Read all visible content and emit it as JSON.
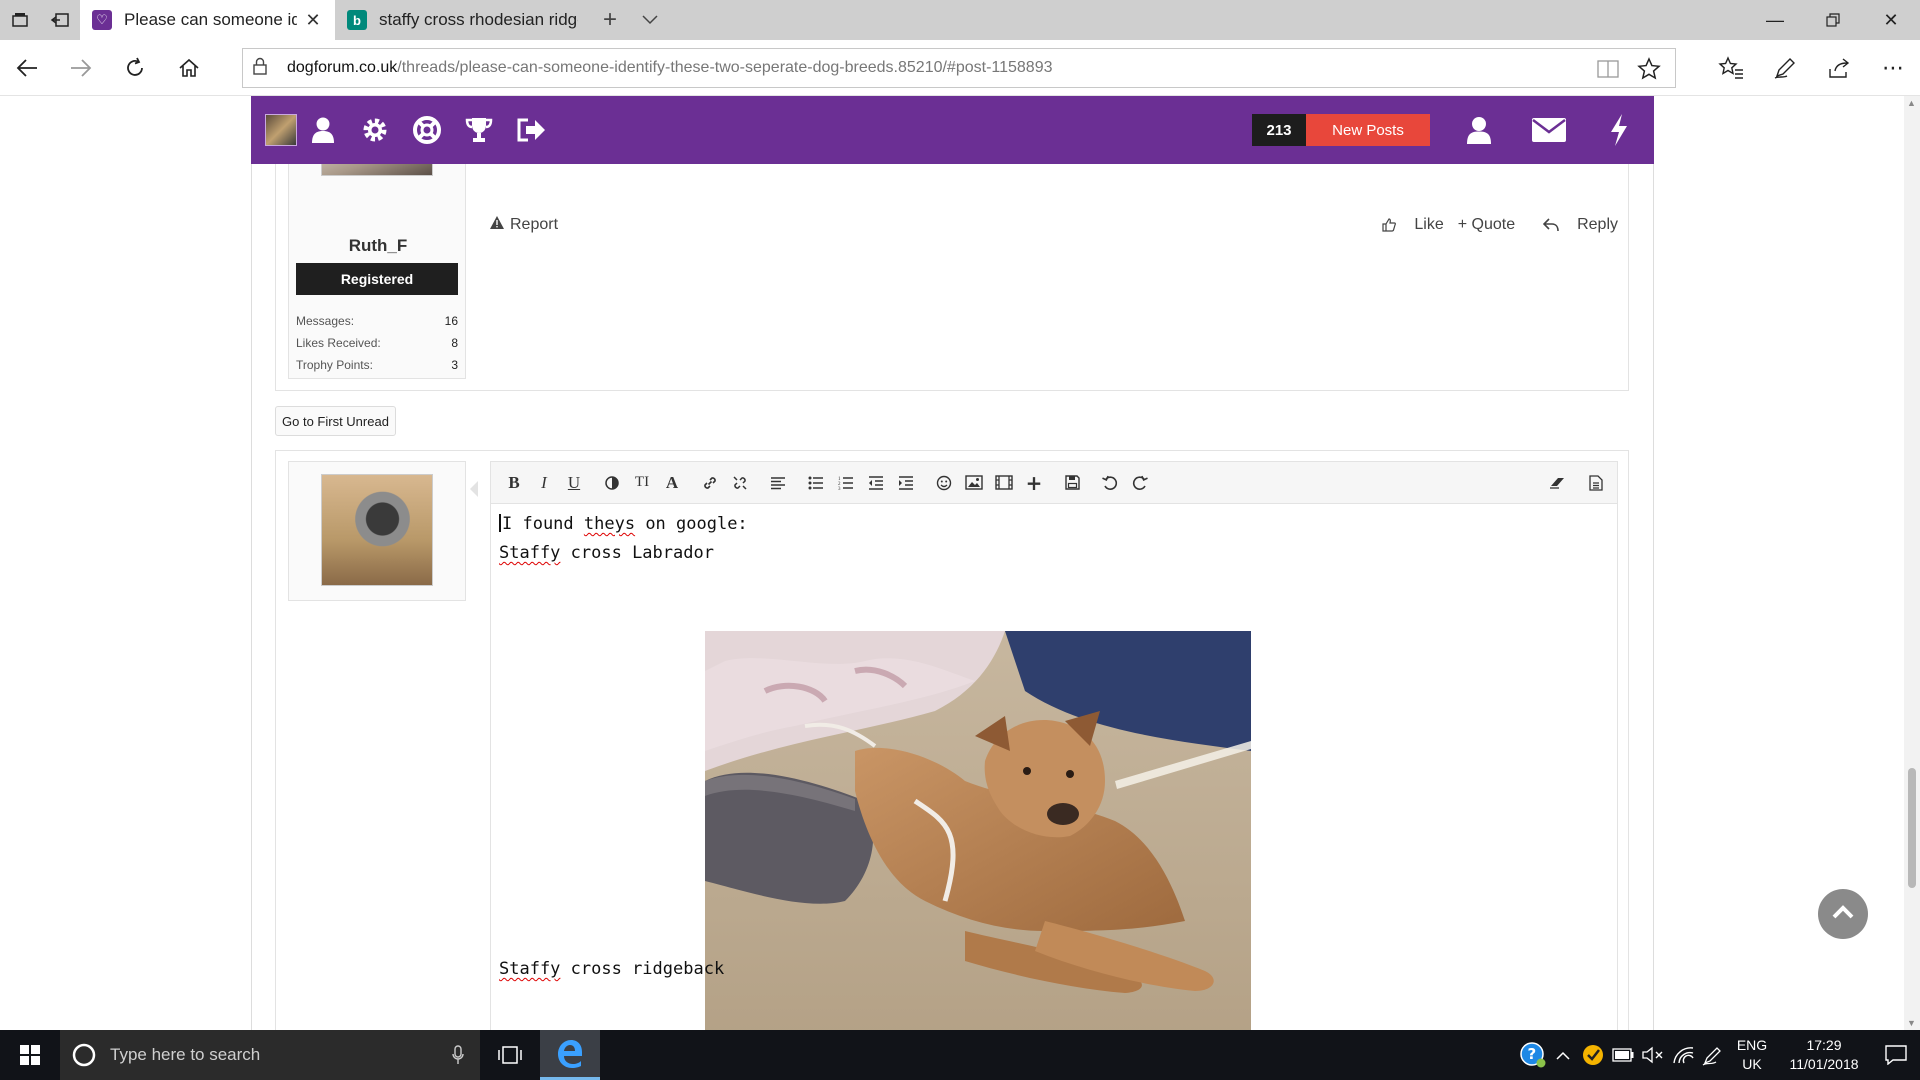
{
  "browser": {
    "tabs": [
      {
        "title": "Please can someone ide",
        "active": true,
        "favicon": "purple-forum-icon"
      },
      {
        "title": "staffy cross rhodesian ridge",
        "active": false,
        "favicon": "bing-icon"
      }
    ],
    "url_host": "dogforum.co.uk",
    "url_path": "/threads/please-can-someone-identify-these-two-seperate-dog-breeds.85210/#post-1158893"
  },
  "forum_header": {
    "alerts_count": "213",
    "new_posts_label": "New Posts",
    "accent": "#6b2f94",
    "new_posts_color": "#e8473b"
  },
  "post": {
    "username": "Ruth_F",
    "role": "Registered",
    "stats": [
      {
        "label": "Messages:",
        "value": "16"
      },
      {
        "label": "Likes Received:",
        "value": "8"
      },
      {
        "label": "Trophy Points:",
        "value": "3"
      }
    ],
    "report_label": "Report",
    "like_label": "Like",
    "quote_label": "+ Quote",
    "reply_label": "Reply"
  },
  "first_unread_label": "Go to First Unread",
  "editor": {
    "line1_a": "I found ",
    "line1_b": "theys",
    "line1_c": " on google:",
    "line2_a": "Staffy",
    "line2_b": " cross Labrador",
    "line3_a": "Staffy",
    "line3_b": " cross ridgeback"
  },
  "taskbar": {
    "search_placeholder": "Type here to search",
    "lang_1": "ENG",
    "lang_2": "UK",
    "time": "17:29",
    "date": "11/01/2018"
  }
}
